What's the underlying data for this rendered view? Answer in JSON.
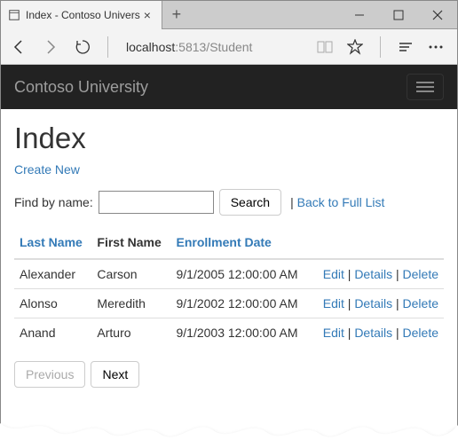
{
  "browser": {
    "tab_title": "Index - Contoso Univers",
    "address_host": "localhost",
    "address_path": ":5813/Student"
  },
  "navbar": {
    "brand": "Contoso University"
  },
  "page": {
    "title": "Index",
    "create_new": "Create New",
    "search_label": "Find by name:",
    "search_value": "",
    "search_button": "Search",
    "back_link": "Back to Full List"
  },
  "table": {
    "headers": {
      "last_name": "Last Name",
      "first_name": "First Name",
      "enrollment_date": "Enrollment Date"
    },
    "actions": {
      "edit": "Edit",
      "details": "Details",
      "delete": "Delete"
    },
    "rows": [
      {
        "last_name": "Alexander",
        "first_name": "Carson",
        "enrollment_date": "9/1/2005 12:00:00 AM"
      },
      {
        "last_name": "Alonso",
        "first_name": "Meredith",
        "enrollment_date": "9/1/2002 12:00:00 AM"
      },
      {
        "last_name": "Anand",
        "first_name": "Arturo",
        "enrollment_date": "9/1/2003 12:00:00 AM"
      }
    ]
  },
  "pager": {
    "previous": "Previous",
    "next": "Next"
  }
}
